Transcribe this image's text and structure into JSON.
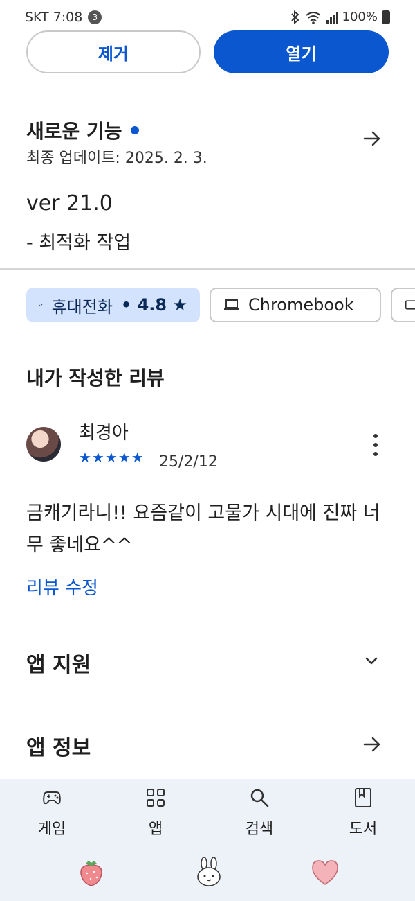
{
  "status_bar": {
    "carrier_time": "SKT 7:08",
    "notification_count": "3",
    "battery": "100%"
  },
  "actions": {
    "remove_label": "제거",
    "open_label": "열기"
  },
  "whats_new": {
    "title": "새로운 기능",
    "last_updated": "최종 업데이트: 2025. 2. 3.",
    "version": "ver 21.0",
    "note": "- 최적화 작업"
  },
  "device_chips": [
    {
      "label": "휴대전화",
      "rating": "• 4.8 ★",
      "selected": true
    },
    {
      "label": "Chromebook",
      "selected": false
    }
  ],
  "my_review": {
    "section_title": "내가 작성한 리뷰",
    "reviewer_name": "최경아",
    "stars": "★★★★★",
    "star_rating": 5,
    "date": "25/2/12",
    "text": "금캐기라니!! 요즘같이 고물가 시대에 진짜 너무 좋네요^^",
    "edit_label": "리뷰 수정"
  },
  "sections": {
    "app_support": "앱 지원",
    "app_info": "앱 정보"
  },
  "bottom_nav": {
    "games": "게임",
    "apps": "앱",
    "search": "검색",
    "books": "도서"
  },
  "colors": {
    "accent": "#0b57d0",
    "chip_selected_bg": "#d3e3fd",
    "nav_bg": "#edf1f8"
  },
  "icons": [
    "bluetooth-icon",
    "wifi-icon",
    "signal-icon",
    "battery-icon",
    "arrow-right-icon",
    "check-icon",
    "laptop-icon",
    "tablet-icon",
    "more-vert-icon",
    "chevron-down-icon",
    "gamepad-icon",
    "apps-grid-icon",
    "search-icon",
    "book-icon",
    "strawberry-icon",
    "bunny-icon",
    "heart-icon"
  ]
}
